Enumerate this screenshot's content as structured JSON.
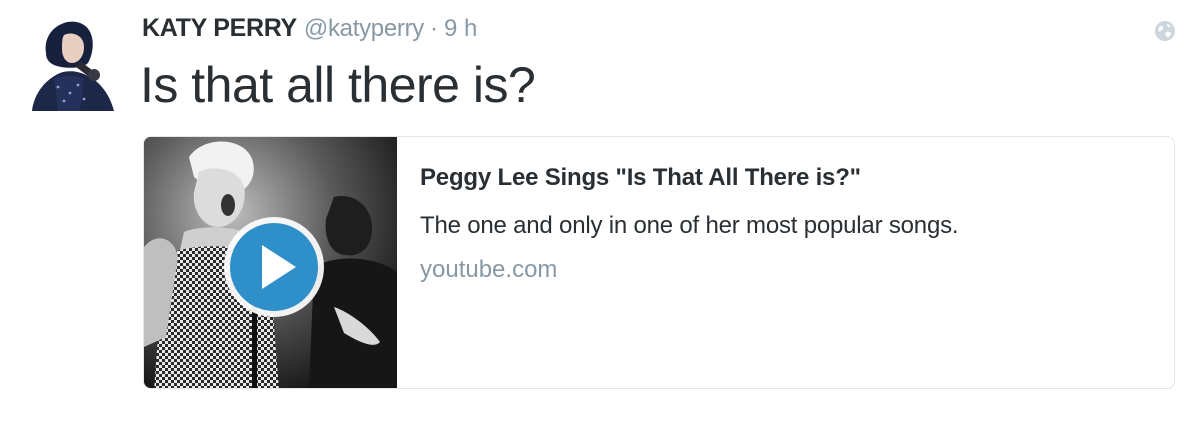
{
  "tweet": {
    "author": {
      "fullname": "KATY PERRY",
      "handle": "@katyperry",
      "separator": "·",
      "time": "9 h"
    },
    "text": "Is that all there is?",
    "globe_icon": "globe-icon",
    "card": {
      "title": "Peggy Lee Sings \"Is That All There is?\"",
      "description": "The one and only in one of her most popular songs.",
      "domain": "youtube.com",
      "play_icon": "play-icon",
      "play_color": "#2f8fc8"
    }
  },
  "colors": {
    "text": "#292f33",
    "muted": "#8899a6",
    "border": "#e1e8ed"
  }
}
